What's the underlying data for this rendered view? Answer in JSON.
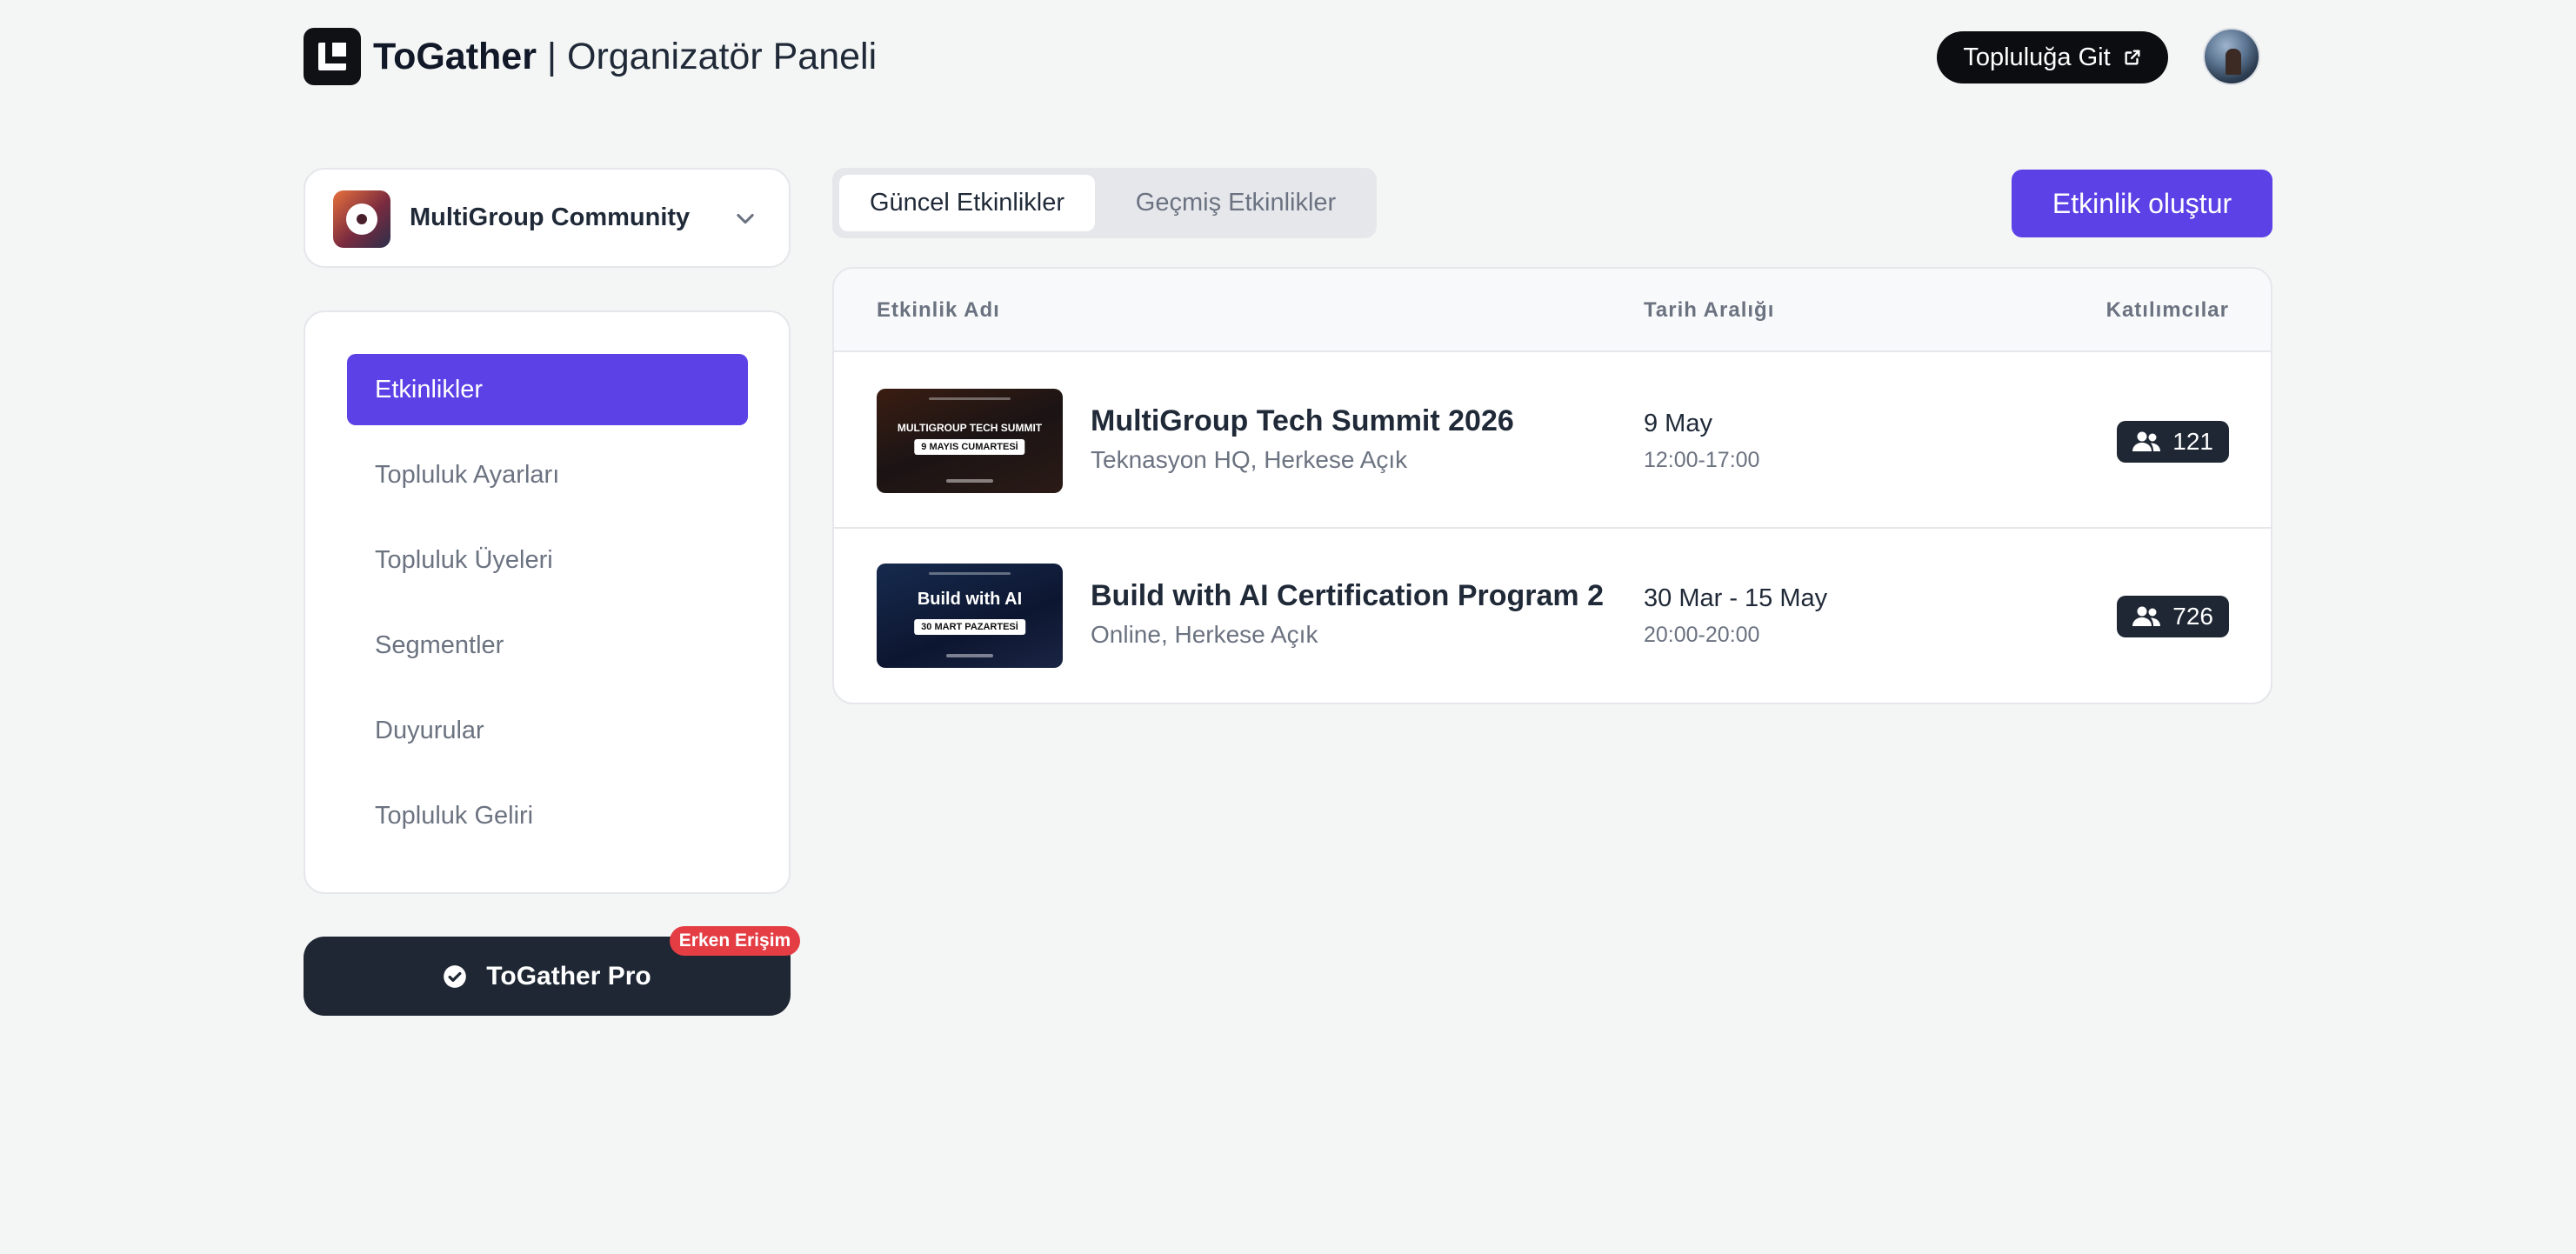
{
  "header": {
    "brand_bold": "ToGather",
    "brand_rest": " | Organizatör Paneli",
    "goto_label": "Topluluğa Git"
  },
  "sidebar": {
    "community_name": "MultiGroup Community",
    "items": [
      {
        "label": "Etkinlikler",
        "active": true
      },
      {
        "label": "Topluluk Ayarları",
        "active": false
      },
      {
        "label": "Topluluk Üyeleri",
        "active": false
      },
      {
        "label": "Segmentler",
        "active": false
      },
      {
        "label": "Duyurular",
        "active": false
      },
      {
        "label": "Topluluk Geliri",
        "active": false
      }
    ],
    "pro_label": "ToGather Pro",
    "pro_badge": "Erken Erişim"
  },
  "main": {
    "tabs": [
      {
        "label": "Güncel Etkinlikler",
        "active": true
      },
      {
        "label": "Geçmiş Etkinlikler",
        "active": false
      }
    ],
    "create_label": "Etkinlik oluştur",
    "columns": {
      "name": "Etkinlik Adı",
      "date": "Tarih Aralığı",
      "participants": "Katılımcılar"
    },
    "events": [
      {
        "thumb_title": "MULTIGROUP TECH SUMMIT",
        "thumb_tag": "9 MAYIS CUMARTESİ",
        "title": "MultiGroup Tech Summit 2026",
        "subtitle": "Teknasyon HQ, Herkese Açık",
        "date": "9 May",
        "time": "12:00-17:00",
        "participants": "121"
      },
      {
        "thumb_title": "Build with AI",
        "thumb_tag": "30 MART PAZARTESİ",
        "title": "Build with AI Certification Program 2...",
        "subtitle": "Online, Herkese Açık",
        "date": "30 Mar - 15 May",
        "time": "20:00-20:00",
        "participants": "726"
      }
    ]
  },
  "colors": {
    "accent": "#5b41e6",
    "dark": "#1e2733",
    "badge_red": "#e43d44",
    "background": "#f4f5f5"
  },
  "icons": {
    "logo": "togather-logo-icon",
    "external": "external-link-icon",
    "chevron": "chevron-down-icon",
    "check": "check-circle-icon",
    "people": "users-icon"
  }
}
